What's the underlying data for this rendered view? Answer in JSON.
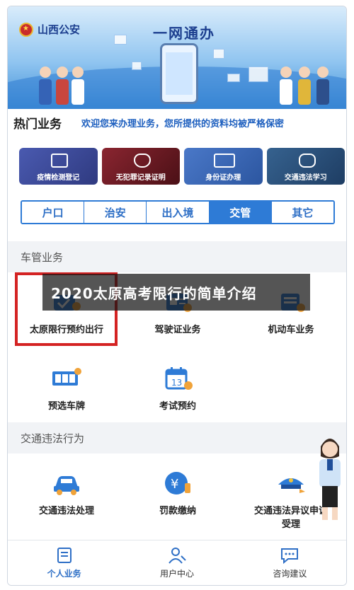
{
  "banner": {
    "org_name": "山西公安",
    "title": "一网通办"
  },
  "hot": {
    "title": "热门业务",
    "notice": "欢迎您来办理业务，您所提供的资料均被严格保密",
    "cards": [
      {
        "label": "疫情检测登记",
        "color": "#3e4a98"
      },
      {
        "label": "无犯罪记录证明",
        "color": "#7a1f28"
      },
      {
        "label": "身份证办理",
        "color": "#3a66b8"
      },
      {
        "label": "交通违法学习",
        "color": "#2a5080"
      }
    ]
  },
  "tabs": [
    {
      "label": "户口",
      "active": false
    },
    {
      "label": "治安",
      "active": false
    },
    {
      "label": "出入境",
      "active": false
    },
    {
      "label": "交管",
      "active": true
    },
    {
      "label": "其它",
      "active": false
    }
  ],
  "vehicle_section": {
    "title": "车管业务",
    "items": [
      {
        "label": "太原限行预约出行",
        "icon": "car-check-icon"
      },
      {
        "label": "驾驶证业务",
        "icon": "license-icon"
      },
      {
        "label": "机动车业务",
        "icon": "vehicle-icon"
      },
      {
        "label": "预选车牌",
        "icon": "license-plate-icon"
      },
      {
        "label": "考试预约",
        "icon": "calendar-icon"
      }
    ]
  },
  "violation_section": {
    "title": "交通违法行为",
    "items": [
      {
        "label": "交通违法处理",
        "icon": "car-icon"
      },
      {
        "label": "罚款缴纳",
        "icon": "yuan-payment-icon"
      },
      {
        "label": "交通违法异议申诉受理",
        "icon": "police-cap-icon"
      }
    ]
  },
  "caption": "2020太原高考限行的简单介绍",
  "bottom_nav": [
    {
      "label": "个人业务",
      "icon": "document-stack-icon",
      "active": true
    },
    {
      "label": "用户中心",
      "icon": "user-edit-icon",
      "active": false
    },
    {
      "label": "咨询建议",
      "icon": "chat-bubble-icon",
      "active": false
    }
  ],
  "colors": {
    "accent": "#2e7bd6",
    "highlight": "#d42323"
  }
}
